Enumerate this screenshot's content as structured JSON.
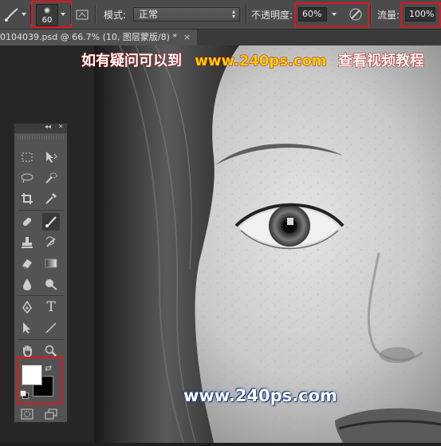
{
  "options_bar": {
    "brush_size": "60",
    "mode_label": "模式:",
    "mode_value": "正常",
    "opacity_label": "不透明度:",
    "opacity_value": "60%",
    "flow_label": "流量:",
    "flow_value": "100%"
  },
  "document_tab": {
    "title": "0104039.psd @ 66.7% (10, 图层蒙版/8) *",
    "close": "×"
  },
  "toolbox": {
    "collapse": "◂◂",
    "close": "✕"
  },
  "watermarks": {
    "top_prefix": "如有疑问可以到",
    "top_url": "www.240ps.com",
    "top_suffix": "查看视频教程",
    "bottom_url": "www.240ps.com"
  },
  "colors": {
    "foreground": "#ffffff",
    "background": "#000000",
    "highlight": "#e0161c",
    "watermark_accent": "#f5d000"
  }
}
